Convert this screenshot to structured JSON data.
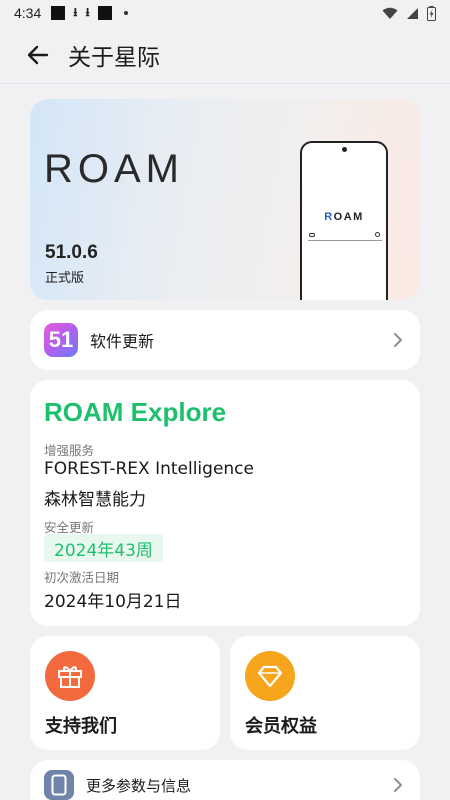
{
  "status_bar": {
    "time": "4:34"
  },
  "app_bar": {
    "title": "关于星际"
  },
  "hero": {
    "logo": "ROAM",
    "version": "51.0.6",
    "channel": "正式版",
    "phone_logo_first": "R",
    "phone_logo_rest": "OAM"
  },
  "update": {
    "badge": "51",
    "label": "软件更新"
  },
  "info": {
    "title": "ROAM Explore",
    "enhanced_label": "增强服务",
    "enhanced_value_en": "FOREST-REX Intelligence",
    "enhanced_value_cn": "森林智慧能力",
    "security_label": "安全更新",
    "security_value": "2024年43周",
    "activation_label": "初次激活日期",
    "activation_value": "2024年10月21日"
  },
  "tiles": {
    "support": "支持我们",
    "member": "会员权益"
  },
  "more": {
    "label": "更多参数与信息"
  },
  "colors": {
    "accent_green": "#1ec06d",
    "support_orange": "#f26a3d",
    "member_yellow": "#f7a51d"
  }
}
